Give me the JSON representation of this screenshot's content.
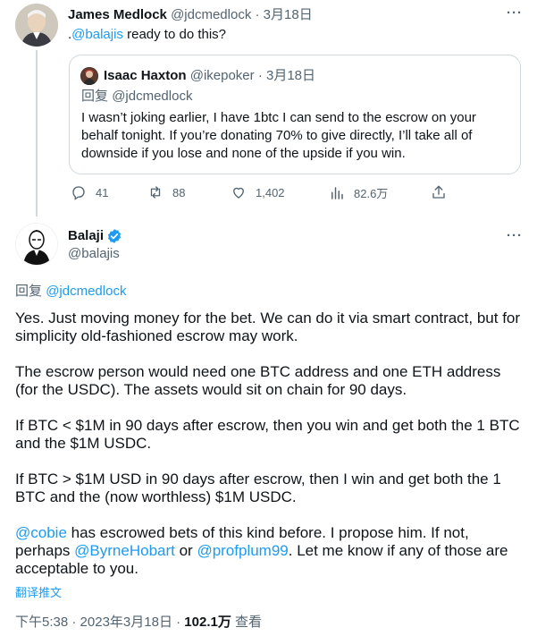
{
  "reply": {
    "author_name": "James Medlock",
    "author_handle": "@jdcmedlock",
    "separator": "·",
    "date": "3月18日",
    "text_prefix": ".",
    "mention": "@balajis",
    "text_rest": " ready to do this?",
    "quote": {
      "author_name": "Isaac Haxton",
      "author_handle": "@ikepoker",
      "separator": "·",
      "date": "3月18日",
      "reply_to_label": "回复",
      "reply_to_handle": "@jdcmedlock",
      "text": "I wasn’t joking earlier, I have 1btc I can send to the escrow on your behalf tonight. If you’re donating 70% to give directly, I’ll take all of downside if you lose and none of the upside if you win."
    },
    "stats": {
      "replies": "41",
      "retweets": "88",
      "likes": "1,402",
      "views": "82.6万"
    }
  },
  "main": {
    "author_name": "Balaji",
    "author_handle": "@balajis",
    "verified_color": "#1d9bf0",
    "reply_to_label": "回复",
    "reply_to_handle": "@jdcmedlock",
    "paragraphs": [
      "Yes. Just moving money for the bet. We can do it via smart contract, but for simplicity old-fashioned escrow may work.",
      "The escrow person would need one BTC address and one ETH address (for the USDC). The assets would sit on chain for 90 days.",
      "If BTC < $1M in 90 days after escrow, then you win and get both the 1 BTC and the $1M USDC.",
      "If BTC > $1M USD in 90 days after escrow, then I win and get both the 1 BTC and the (now worthless) $1M USDC."
    ],
    "last_paragraph": {
      "mention1": "@cobie",
      "text1": " has escrowed bets of this kind before. I propose him. If not, perhaps ",
      "mention2": "@ByrneHobart",
      "text2": " or ",
      "mention3": "@profplum99",
      "text3": ". Let me know if any of those are acceptable to you."
    },
    "translate_label": "翻译推文",
    "time": "下午5:38",
    "separator": "·",
    "date": "2023年3月18日",
    "views_count": "102.1万",
    "views_label": "查看"
  },
  "colors": {
    "accent": "#1d9bf0",
    "text": "#0f1419",
    "muted": "#536471",
    "border": "#cfd9de"
  },
  "icons": [
    "more-icon",
    "reply-icon",
    "retweet-icon",
    "like-icon",
    "views-icon",
    "share-icon",
    "verified-badge-icon"
  ]
}
